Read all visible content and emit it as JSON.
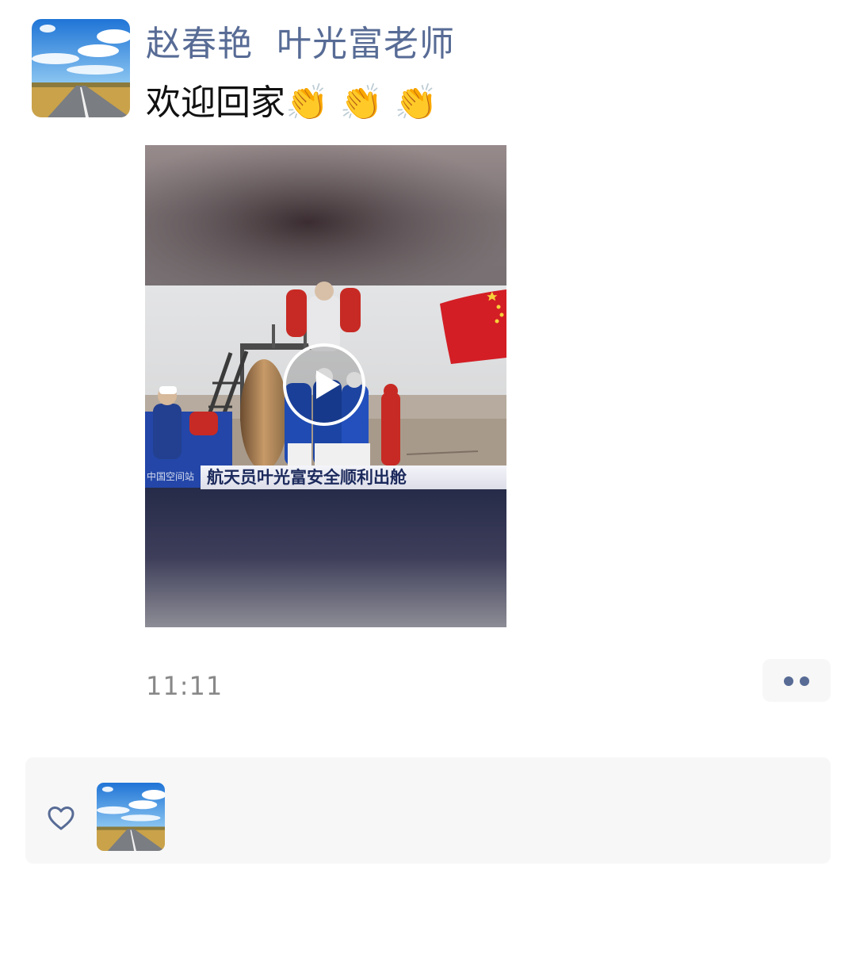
{
  "post": {
    "author": "赵春艳  叶光富老师",
    "text": "欢迎回家👏 👏 👏",
    "timestamp": "11:11",
    "avatar_icon": "landscape-road-avatar"
  },
  "video": {
    "caption": "航天员叶光富安全顺利出舱",
    "channel_logo": "中国空间站",
    "play_icon": "play-icon"
  },
  "actions": {
    "more_icon": "more-dots-icon"
  },
  "likes": {
    "heart_icon": "heart-outline-icon",
    "avatars": [
      "landscape-road-avatar"
    ]
  },
  "colors": {
    "link_blue": "#576b95",
    "text_black": "#111111",
    "timestamp_gray": "#888888",
    "panel_bg": "#f7f7f7"
  }
}
